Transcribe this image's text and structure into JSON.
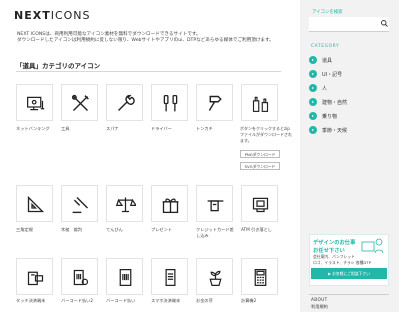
{
  "colors": {
    "accent": "#22b7a8",
    "sidebar_bg": "#f2f2f2",
    "card_border": "#e3e3e3"
  },
  "header": {
    "logo_bold": "NEXT",
    "logo_thin": "ICONS",
    "intro_line1": "NEXT ICONSは、商用利用可能なアイコン素材を無料でダウンロードできるサイトです。",
    "intro_line2": "ダウンロードしたアイコンは利用規約に反しない限り、Webサイトやアプリのui、DTPなどあらゆる媒体でご利用頂けます。"
  },
  "section": {
    "title": "「道具」カテゴリのアイコン"
  },
  "icons": [
    {
      "label": "ネットバンキング",
      "icon": "net-banking-icon"
    },
    {
      "label": "工具",
      "icon": "tools-icon"
    },
    {
      "label": "スパナ",
      "icon": "spanner-icon"
    },
    {
      "label": "ドライバー",
      "icon": "screwdriver-icon"
    },
    {
      "label": "トンカチ",
      "icon": "hammer-icon"
    },
    {
      "label": "",
      "icon": "paint-bottles-icon"
    },
    {
      "label": "三角定規",
      "icon": "set-square-icon"
    },
    {
      "label": "木槌　裁判",
      "icon": "gavel-icon"
    },
    {
      "label": "てんびん",
      "icon": "scales-icon"
    },
    {
      "label": "プレゼント",
      "icon": "present-icon"
    },
    {
      "label": "クレジットカード差し込み",
      "icon": "card-insert-icon"
    },
    {
      "label": "ATM 引き落とし",
      "icon": "atm-icon"
    },
    {
      "label": "タッチ決済端末",
      "icon": "touch-payment-icon"
    },
    {
      "label": "バーコード払い2",
      "icon": "barcode-pay2-icon"
    },
    {
      "label": "バーコード払い",
      "icon": "barcode-pay-icon"
    },
    {
      "label": "スマホ決済端末",
      "icon": "phone-payment-icon"
    },
    {
      "label": "お金の芽",
      "icon": "money-sprout-icon"
    },
    {
      "label": "計算機2",
      "icon": "calculator-icon"
    }
  ],
  "popup": {
    "text": "ボタンをクリックするとzipファイルがダウンロードされます。",
    "png_label": "PNGダウンロード",
    "svg_label": "SVGダウンロード"
  },
  "sidebar": {
    "search_label": "アイコンを検索",
    "search_placeholder": "",
    "category_label": "CATEGORY",
    "categories": [
      "道具",
      "UI・記号",
      "人",
      "建物・自然",
      "乗り物",
      "季節・天候"
    ],
    "banner_title": "デザインのお仕事",
    "banner_title2": "お任せ下さい",
    "banner_sub1": "会社案内、パンフレット",
    "banner_sub2": "ロゴ、イラスト、チラシ 各種DTP",
    "banner_button": "▶ お気軽にご相談下さい",
    "about": "ABOUT",
    "terms": "利用規約"
  }
}
